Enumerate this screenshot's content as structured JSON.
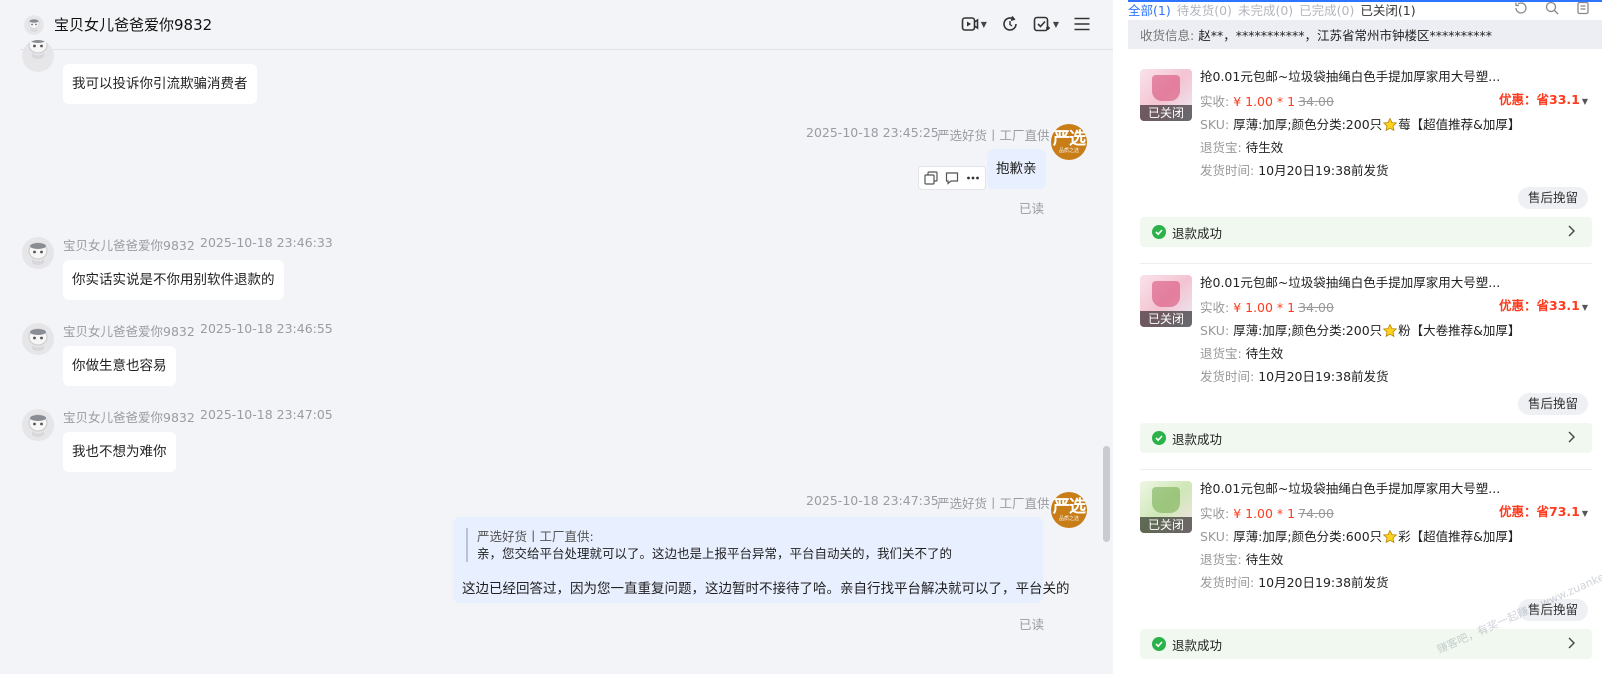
{
  "chat": {
    "title": "宝贝女儿爸爸爱你9832",
    "messages": [
      {
        "text": "我可以投诉你引流欺骗消费者"
      },
      {
        "time": "2025-10-18 23:45:25",
        "sender": "严选好货丨工厂直供",
        "text": "抱歉亲",
        "read": "已读"
      },
      {
        "sender": "宝贝女儿爸爸爱你9832",
        "time": "2025-10-18 23:46:33",
        "text": "你实话实说是不你用别软件退款的"
      },
      {
        "sender": "宝贝女儿爸爸爱你9832",
        "time": "2025-10-18 23:46:55",
        "text": "你做生意也容易"
      },
      {
        "sender": "宝贝女儿爸爸爱你9832",
        "time": "2025-10-18 23:47:05",
        "text": "我也不想为难你"
      },
      {
        "time": "2025-10-18 23:47:35",
        "sender": "严选好货丨工厂直供",
        "quote_sender": "严选好货丨工厂直供:",
        "quote_text": "亲，您交给平台处理就可以了。这边也是上报平台异常，平台自动关的，我们关不了的",
        "text": "这边已经回答过，因为您一直重复问题，这边暂时不接待了哈。亲自行找平台解决就可以了，平台关的",
        "read": "已读"
      }
    ],
    "shop_avatar": {
      "big": "严选",
      "small": "品质之选"
    }
  },
  "orders": {
    "tabs": [
      "全部(1)",
      "待发货(0)",
      "未完成(0)",
      "已完成(0)",
      "已关闭(1)"
    ],
    "address_label": "收货信息:",
    "address_value": "赵**，***********，江苏省常州市钟楼区**********",
    "items": [
      {
        "tag": "已关闭",
        "name": "抢0.01元包邮~垃圾袋抽绳白色手提加厚家用大号塑...",
        "paid_label": "实收:",
        "price": "¥ 1.00 * 1",
        "orig": "34.00",
        "discount": "优惠：省33.1",
        "sku_label": "SKU:",
        "sku_pre": "厚薄:加厚;颜色分类:200只",
        "sku_post": "莓【超值推荐&加厚】",
        "return_label": "退货宝:",
        "return_value": "待生效",
        "ship_label": "发货时间:",
        "ship_value": "10月20日19:38前发货",
        "service_btn": "售后挽留",
        "refund": "退款成功"
      },
      {
        "tag": "已关闭",
        "name": "抢0.01元包邮~垃圾袋抽绳白色手提加厚家用大号塑...",
        "paid_label": "实收:",
        "price": "¥ 1.00 * 1",
        "orig": "34.00",
        "discount": "优惠：省33.1",
        "sku_label": "SKU:",
        "sku_pre": "厚薄:加厚;颜色分类:200只",
        "sku_post": "粉【大卷推荐&加厚】",
        "return_label": "退货宝:",
        "return_value": "待生效",
        "ship_label": "发货时间:",
        "ship_value": "10月20日19:38前发货",
        "service_btn": "售后挽留",
        "refund": "退款成功"
      },
      {
        "tag": "已关闭",
        "name": "抢0.01元包邮~垃圾袋抽绳白色手提加厚家用大号塑...",
        "paid_label": "实收:",
        "price": "¥ 1.00 * 1",
        "orig": "74.00",
        "discount": "优惠：省73.1",
        "sku_label": "SKU:",
        "sku_pre": "厚薄:加厚;颜色分类:600只",
        "sku_post": "彩【超值推荐&加厚】",
        "return_label": "退货宝:",
        "return_value": "待生效",
        "ship_label": "发货时间:",
        "ship_value": "10月20日19:38前发货",
        "service_btn": "售后挽留",
        "refund": "退款成功"
      }
    ]
  },
  "watermark": "赚客吧，有奖一起赚！ www.zuanke8.com"
}
